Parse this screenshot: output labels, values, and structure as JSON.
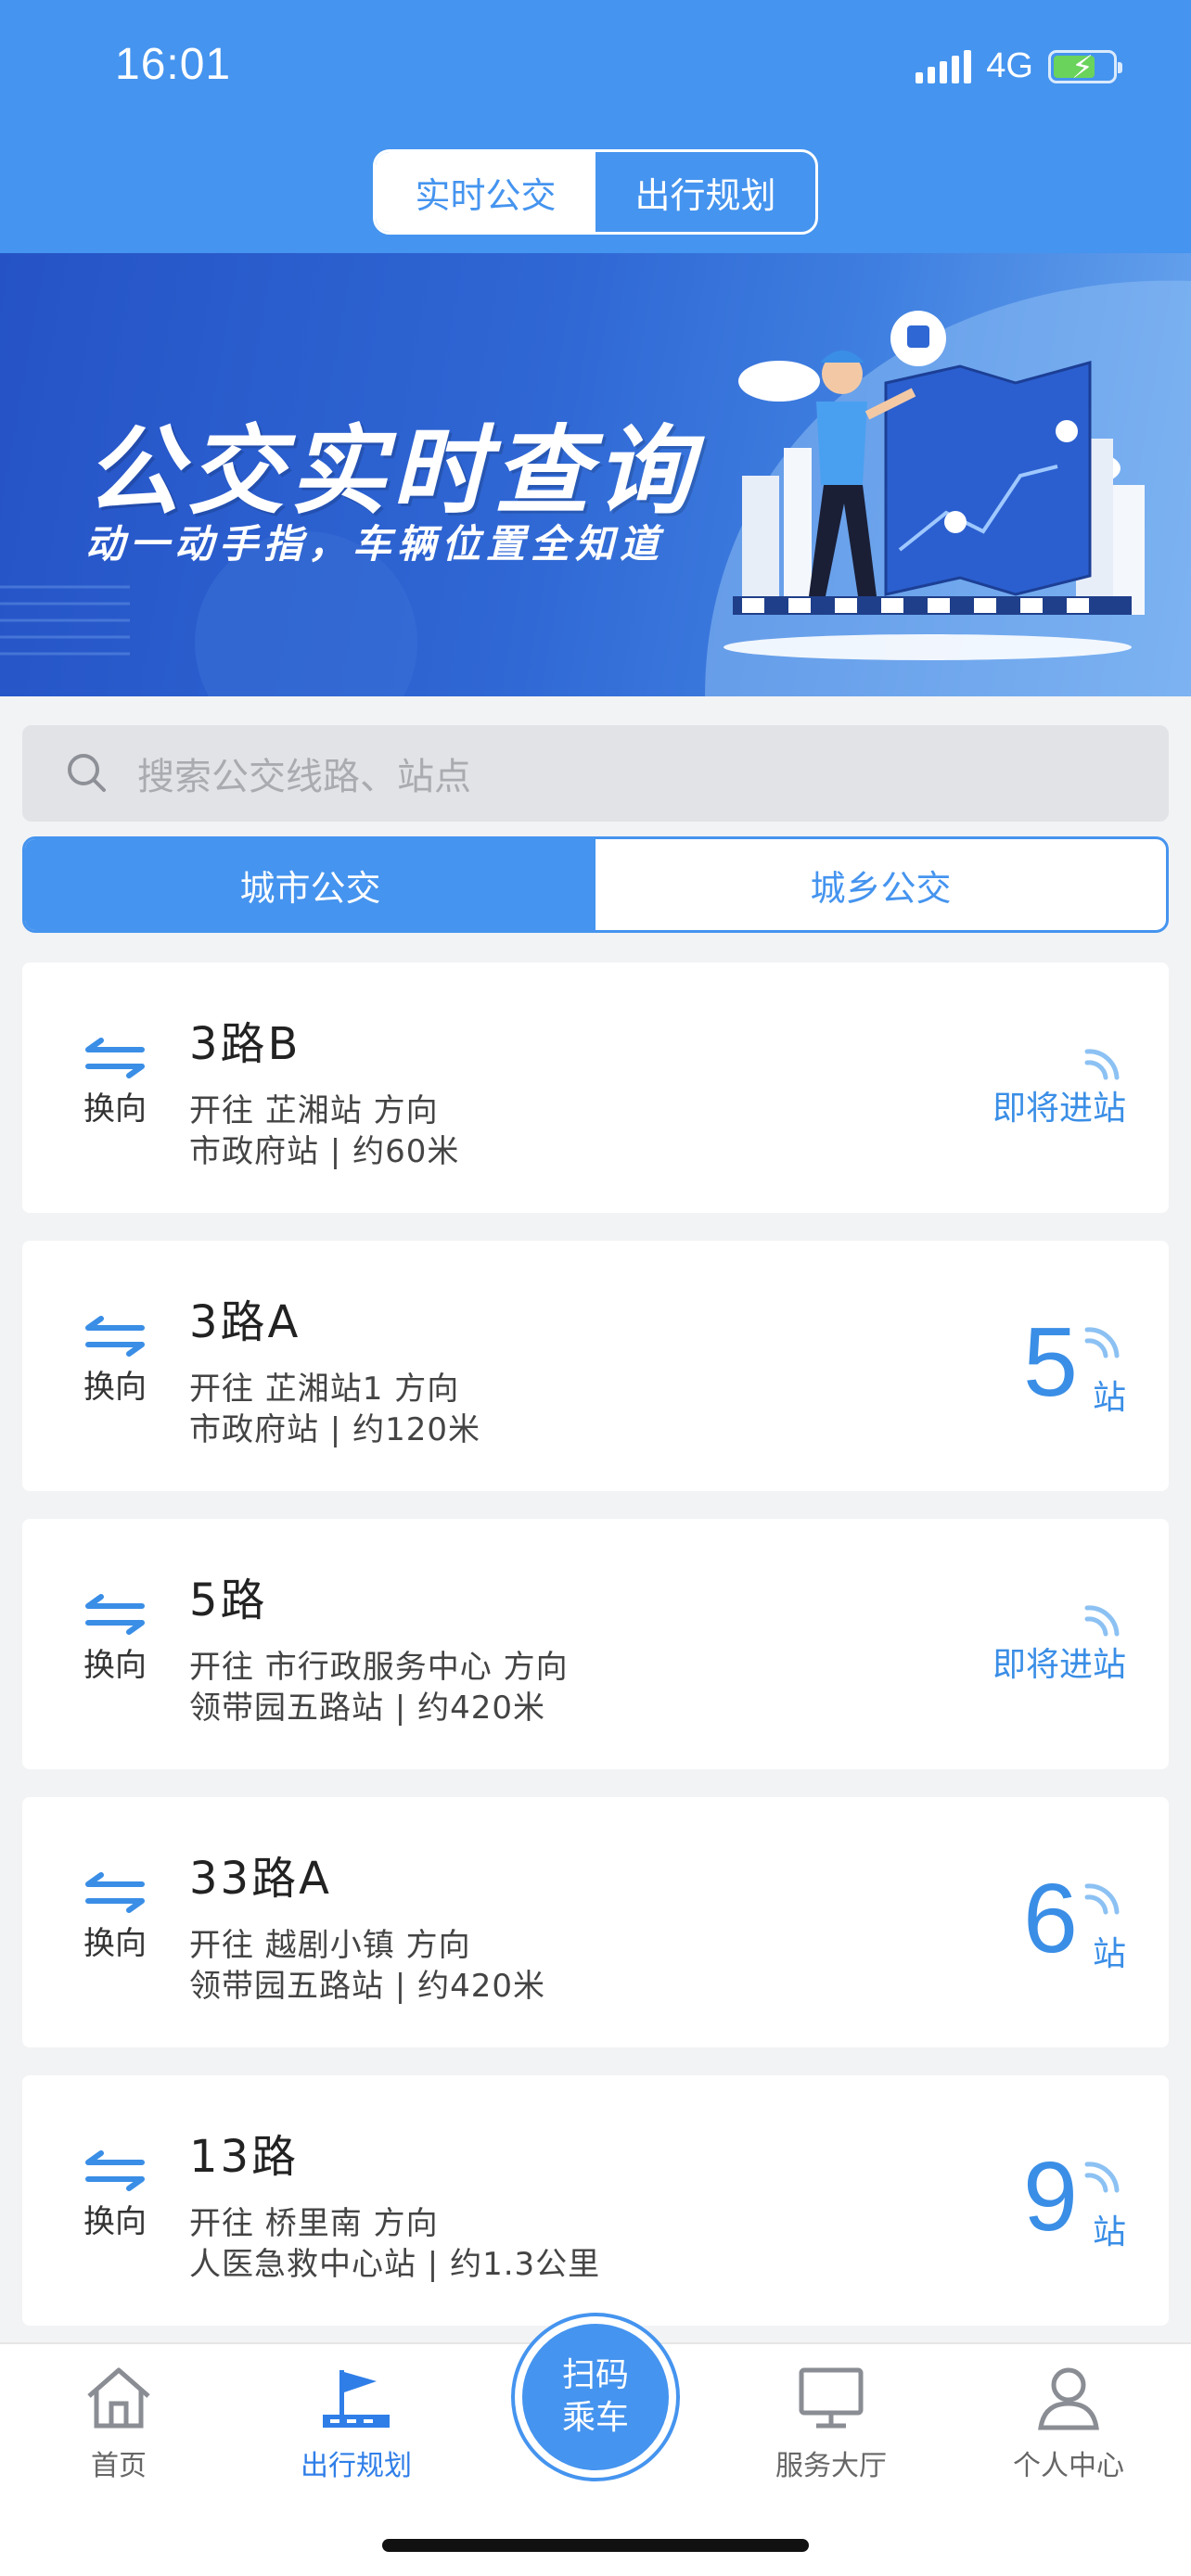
{
  "status_bar": {
    "time": "16:01",
    "network": "4G"
  },
  "top_tabs": {
    "realtime": "实时公交",
    "planning": "出行规划"
  },
  "banner": {
    "title": "公交实时查询",
    "subtitle": "动一动手指，车辆位置全知道"
  },
  "search": {
    "placeholder": "搜索公交线路、站点"
  },
  "bus_type_tabs": {
    "city": "城市公交",
    "rural": "城乡公交"
  },
  "routes": [
    {
      "swap_label": "换向",
      "name": "3路B",
      "direction": "开往 芷湘站 方向",
      "stop": "市政府站 | 约60米",
      "arrival_text": "即将进站"
    },
    {
      "swap_label": "换向",
      "name": "3路A",
      "direction": "开往 芷湘站1 方向",
      "stop": "市政府站 | 约120米",
      "stops_away": "5",
      "stops_unit": "站"
    },
    {
      "swap_label": "换向",
      "name": "5路",
      "direction": "开往 市行政服务中心 方向",
      "stop": "领带园五路站 | 约420米",
      "arrival_text": "即将进站"
    },
    {
      "swap_label": "换向",
      "name": "33路A",
      "direction": "开往 越剧小镇 方向",
      "stop": "领带园五路站 | 约420米",
      "stops_away": "6",
      "stops_unit": "站"
    },
    {
      "swap_label": "换向",
      "name": "13路",
      "direction": "开往 桥里南 方向",
      "stop": "人医急救中心站 | 约1.3公里",
      "stops_away": "9",
      "stops_unit": "站"
    }
  ],
  "tabbar": {
    "home": "首页",
    "planning": "出行规划",
    "scan_line1": "扫码",
    "scan_line2": "乘车",
    "service": "服务大厅",
    "profile": "个人中心"
  },
  "colors": {
    "primary": "#4594ef",
    "accent_text": "#3a8ee6",
    "background": "#f2f3f5"
  }
}
